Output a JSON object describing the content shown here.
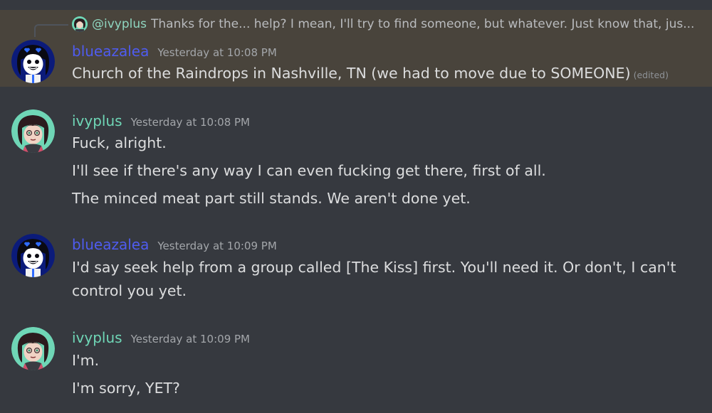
{
  "reply": {
    "username": "@ivyplus",
    "text": "Thanks for the... help? I mean, I'll try to find someone, but whatever. Just know that, jus..."
  },
  "messages": [
    {
      "username": "blueazalea",
      "timestamp": "Yesterday at 10:08 PM",
      "lines": [
        "Church of the Raindrops in Nashville, TN (we had to move due to SOMEONE)"
      ],
      "edited_label": "(edited)"
    },
    {
      "username": "ivyplus",
      "timestamp": "Yesterday at 10:08 PM",
      "lines": [
        "Fuck, alright.",
        "I'll see if there's any way I can even fucking get there, first of all.",
        "The minced meat part still stands. We aren't done yet."
      ]
    },
    {
      "username": "blueazalea",
      "timestamp": "Yesterday at 10:09 PM",
      "lines": [
        "I'd say seek help from a group called [The Kiss] first. You'll need it. Or don't, I can't",
        "control you yet."
      ]
    },
    {
      "username": "ivyplus",
      "timestamp": "Yesterday at 10:09 PM",
      "lines": [
        "I'm.",
        "I'm sorry, YET?"
      ]
    }
  ],
  "colors": {
    "background": "#36393f",
    "highlight": "#49443c",
    "blueazalea_name": "#4f5cf0",
    "ivyplus_name": "#6fd6b6"
  },
  "icons": {
    "blueazalea_avatar": "avatar-blueazalea-icon",
    "ivyplus_avatar": "avatar-ivyplus-icon",
    "reply_spine": "reply-spine-icon"
  }
}
